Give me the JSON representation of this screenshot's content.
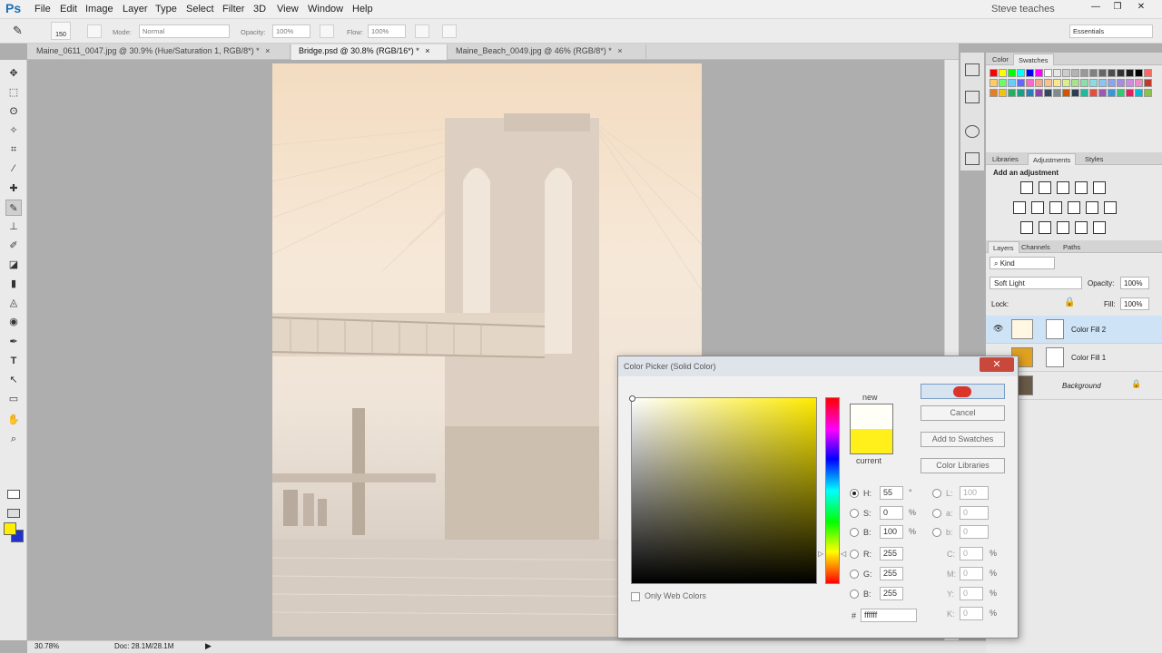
{
  "app": {
    "logo": "Ps",
    "user": "Steve teaches"
  },
  "menu": [
    "File",
    "Edit",
    "Image",
    "Layer",
    "Type",
    "Select",
    "Filter",
    "3D",
    "View",
    "Window",
    "Help"
  ],
  "window_buttons": [
    "—",
    "❐",
    "✕"
  ],
  "options_bar": {
    "brush_size": "150",
    "mode_label": "Mode:",
    "mode_value": "Normal",
    "opacity_label": "Opacity:",
    "opacity_value": "100%",
    "flow_label": "Flow:",
    "flow_value": "100%",
    "workspace": "Essentials"
  },
  "tabs": [
    {
      "label": "Maine_0611_0047.jpg @ 30.9% (Hue/Saturation 1, RGB/8*) *",
      "active": false
    },
    {
      "label": "Bridge.psd @ 30.8% (RGB/16*) *",
      "active": true
    },
    {
      "label": "Maine_Beach_0049.jpg @ 46% (RGB/8*) *",
      "active": false
    }
  ],
  "tab_close": "×",
  "tools": [
    "✥",
    "⬚",
    "ʘ",
    "✧",
    "⌗",
    "⁄",
    "✚",
    "✎",
    "⊥",
    "✐",
    "◪",
    "▮",
    "◬",
    "◉",
    "✒",
    "T",
    "↖",
    "▭",
    "✋",
    "⌕"
  ],
  "colors": {
    "foreground": "#ffee00",
    "background": "#1f33cc",
    "accent": "#7a9cc3"
  },
  "status": {
    "zoom": "30.78%",
    "doc": "Doc: 28.1M/28.1M"
  },
  "panels": {
    "color_tabs": [
      "Color",
      "Swatches"
    ],
    "adjust_tabs": [
      "Libraries",
      "Adjustments",
      "Styles"
    ],
    "add_adjustment": "Add an adjustment",
    "layers_tabs": [
      "Layers",
      "Channels",
      "Paths"
    ],
    "kind": "Kind",
    "blend_mode": "Soft Light",
    "opacity_label": "Opacity:",
    "opacity_value": "100%",
    "lock_label": "Lock:",
    "fill_label": "Fill:",
    "fill_value": "100%",
    "layers": [
      {
        "name": "Color Fill 2",
        "active": true,
        "thumb": "#fff7e2"
      },
      {
        "name": "Color Fill 1",
        "active": false,
        "thumb": "#e0a020"
      },
      {
        "name": "Background",
        "active": false,
        "thumb": "#6a5a48"
      }
    ]
  },
  "swatches": [
    "#ff0000",
    "#ffff00",
    "#00ff00",
    "#00ffff",
    "#0000ff",
    "#ff00ff",
    "#ffffff",
    "#e6e6e6",
    "#cccccc",
    "#b3b3b3",
    "#999999",
    "#808080",
    "#666666",
    "#4d4d4d",
    "#333333",
    "#1a1a1a",
    "#000000",
    "#ff6666",
    "#ffcc66",
    "#66ff66",
    "#66ccff",
    "#6666ff",
    "#ff66cc",
    "#f5a88c",
    "#f7c28c",
    "#fde68c",
    "#d8ef8c",
    "#a8e28c",
    "#8cdcae",
    "#8cdbe0",
    "#8cc4ee",
    "#8ca4e8",
    "#a48ce2",
    "#cc8ce2",
    "#ee8cc4",
    "#c0392b",
    "#e67e22",
    "#f1c40f",
    "#27ae60",
    "#16a085",
    "#2980b9",
    "#8e44ad",
    "#34495e",
    "#7f8c8d",
    "#d35400",
    "#2c3e50",
    "#1abc9c",
    "#e74c3c",
    "#9b59b6",
    "#3498db",
    "#2ecc71",
    "#e91e63",
    "#00bcd4",
    "#8bc34a"
  ],
  "dialog": {
    "title": "Color Picker (Solid Color)",
    "close": "✕",
    "new_label": "new",
    "current_label": "current",
    "ok": "OK",
    "cancel": "Cancel",
    "add_to_swatches": "Add to Swatches",
    "color_libraries": "Color Libraries",
    "only_web_colors": "Only Web Colors",
    "fields": {
      "H": {
        "value": "55",
        "unit": "°"
      },
      "S": {
        "value": "0",
        "unit": "%"
      },
      "B": {
        "value": "100",
        "unit": "%"
      },
      "R": {
        "value": "255"
      },
      "G": {
        "value": "255"
      },
      "Bb": {
        "value": "255"
      },
      "L": {
        "value": "100"
      },
      "a": {
        "value": "0"
      },
      "b": {
        "value": "0"
      },
      "C": {
        "value": "0",
        "unit": "%"
      },
      "M": {
        "value": "0",
        "unit": "%"
      },
      "Y": {
        "value": "0",
        "unit": "%"
      },
      "K": {
        "value": "0",
        "unit": "%"
      }
    },
    "hex_label": "#",
    "hex": "ffffff",
    "new_color": "#fffff8",
    "current_color": "#fff01c"
  }
}
